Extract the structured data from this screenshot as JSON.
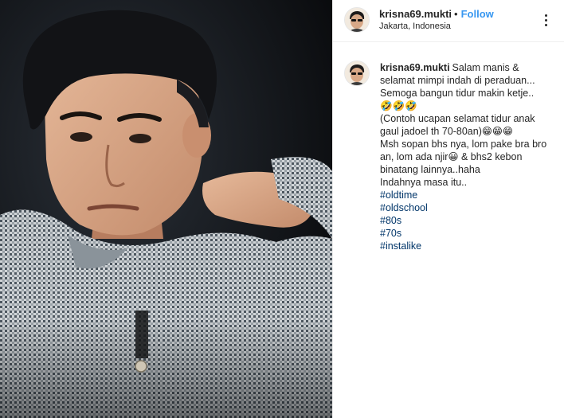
{
  "post": {
    "username": "krisna69.mukti",
    "separator": "•",
    "follow_label": "Follow",
    "location": "Jakarta, Indonesia"
  },
  "caption": {
    "username": "krisna69.mukti",
    "lines": [
      "Salam manis &",
      "selamat mimpi indah di peraduan...",
      "Semoga bangun tidur makin ketje..",
      "🤣🤣🤣",
      "(Contoh ucapan selamat tidur anak",
      "gaul jadoel th 70-80an)😁😁😁",
      "Msh sopan bhs nya, lom pake bra bro",
      "an, lom ada njir😀 & bhs2 kebon",
      "binatang lainnya..haha",
      "Indahnya masa itu.."
    ],
    "hashtags": [
      "#oldtime",
      "#oldschool",
      "#80s",
      "#70s",
      "#instalike"
    ]
  },
  "icons": {
    "more": "more-options-icon",
    "avatar": "avatar"
  },
  "colors": {
    "link": "#3897f0",
    "hashtag": "#003569",
    "text": "#262626",
    "border": "#efefef"
  }
}
